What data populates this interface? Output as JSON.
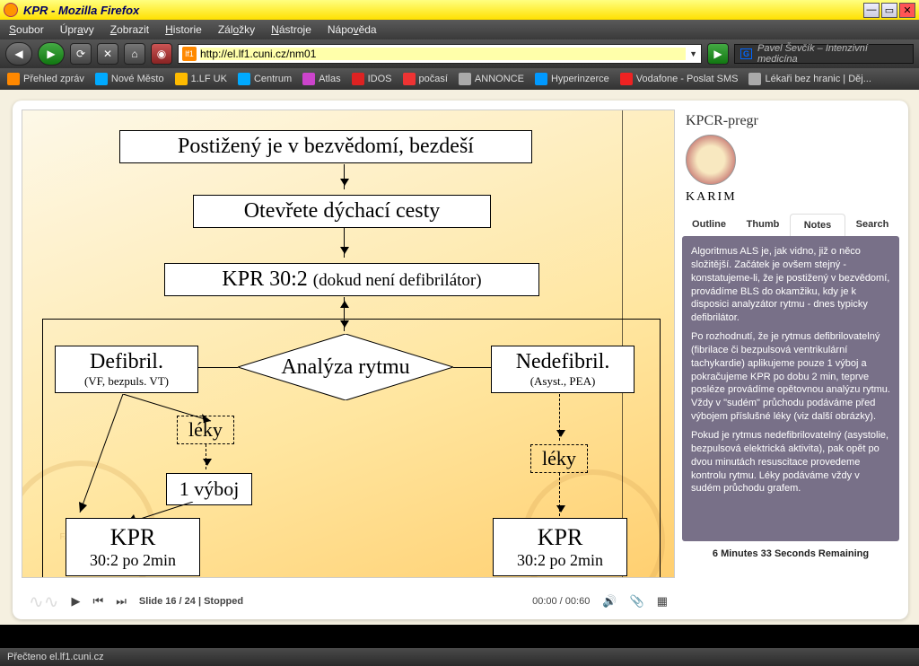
{
  "window": {
    "title": "KPR - Mozilla Firefox"
  },
  "menu": [
    "Soubor",
    "Úpravy",
    "Zobrazit",
    "Historie",
    "Záložky",
    "Nástroje",
    "Nápověda"
  ],
  "url": "http://el.lf1.cuni.cz/nm01",
  "search_hint": "Pavel Ševčík – Intenzivní medicína",
  "bookmarks": [
    {
      "label": "Přehled zpráv",
      "color": "#f80"
    },
    {
      "label": "Nové Město",
      "color": "#0af"
    },
    {
      "label": "1.LF UK",
      "color": "#fb0"
    },
    {
      "label": "Centrum",
      "color": "#0af"
    },
    {
      "label": "Atlas",
      "color": "#c4c"
    },
    {
      "label": "IDOS",
      "color": "#d22"
    },
    {
      "label": "počasí",
      "color": "#e33"
    },
    {
      "label": "ANNONCE",
      "color": "#aaa"
    },
    {
      "label": "Hyperinzerce",
      "color": "#09f"
    },
    {
      "label": "Vodafone - Poslat SMS",
      "color": "#e22"
    },
    {
      "label": "Lékaři bez hranic | Děj...",
      "color": "#aaa"
    }
  ],
  "slide": {
    "b1": "Postižený je v bezvědomí, bezdeší",
    "b2": "Otevřete dýchací cesty",
    "b3_a": "KPR 30:2 ",
    "b3_b": "(dokud není defibrilátor)",
    "diamond": "Analýza rytmu",
    "left_t": "Defibril.",
    "left_s": "(VF, bezpuls. VT)",
    "right_t": "Nedefibril.",
    "right_s": "(Asyst., PEA)",
    "leky": "léky",
    "vyboj": "1 výboj",
    "kpr_t": "KPR",
    "kpr_s": "30:2 po 2min"
  },
  "side": {
    "title": "KPCR-pregr",
    "karim": "KARIM",
    "tabs": [
      "Outline",
      "Thumb",
      "Notes",
      "Search"
    ],
    "active": 2,
    "notes": [
      "Algoritmus ALS je, jak vidno, již o něco složitější. Začátek je ovšem stejný - konstatujeme-li, že je postižený v bezvědomí, provádíme BLS do okamžiku, kdy je k disposici analyzátor rytmu - dnes typicky defibrilátor.",
      "Po rozhodnutí, že je rytmus defibrilovatelný (fibrilace či bezpulsová ventrikulární tachykardie) aplikujeme pouze 1 výboj a pokračujeme KPR po dobu 2 min, teprve posléze provádíme opětovnou analýzu rytmu. Vždy v \"sudém\" průchodu podáváme před výbojem příslušné léky (viz další obrázky).",
      "Pokud je rytmus nedefibrilovatelný (asystolie, bezpulsová elektrická aktivita), pak opět po dvou minutách resuscitace provedeme kontrolu rytmu. Léky podáváme vždy v sudém průchodu grafem."
    ],
    "remaining": "6 Minutes 33 Seconds Remaining"
  },
  "player": {
    "slide": "Slide 16 / 24 | Stopped",
    "time": "00:00 / 00:60"
  },
  "status": "Přečteno el.lf1.cuni.cz"
}
